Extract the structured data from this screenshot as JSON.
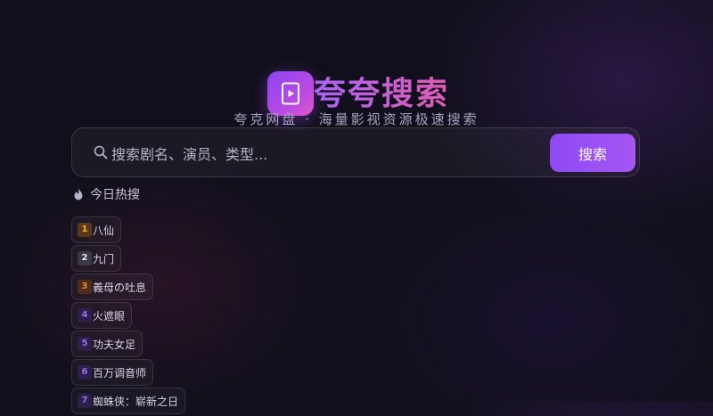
{
  "brand": {
    "title": "夸夸搜索",
    "subtitle": "夸克网盘 · 海量影视资源极速搜索",
    "logo_icon": "play-file-icon"
  },
  "search": {
    "placeholder": "搜索剧名、演员、类型...",
    "value": "",
    "button_label": "搜索",
    "icon": "search-icon"
  },
  "hot": {
    "icon": "fire-icon",
    "title": "今日热搜",
    "items": [
      {
        "rank": "1",
        "label": "八仙"
      },
      {
        "rank": "2",
        "label": "九门"
      },
      {
        "rank": "3",
        "label": "義母の吐息"
      },
      {
        "rank": "4",
        "label": "火遮眼"
      },
      {
        "rank": "5",
        "label": "功夫女足"
      },
      {
        "rank": "6",
        "label": "百万调音师"
      },
      {
        "rank": "7",
        "label": "蜘蛛侠：崭新之日"
      }
    ]
  },
  "colors": {
    "background": "#110f1b",
    "accent": "#9b50f4",
    "title_gradient_start": "#a865f5",
    "title_gradient_end": "#e05bb4",
    "rank1_bg": "#5a3a16",
    "rank1_fg": "#f2b33d",
    "rank2_bg": "#3a3845",
    "rank2_fg": "#e6e6ee",
    "rank3_bg": "#4e2e18",
    "rank3_fg": "#e28a3c",
    "rank_other_bg": "#2c1f4a",
    "rank_other_fg": "#9b6cf0"
  }
}
